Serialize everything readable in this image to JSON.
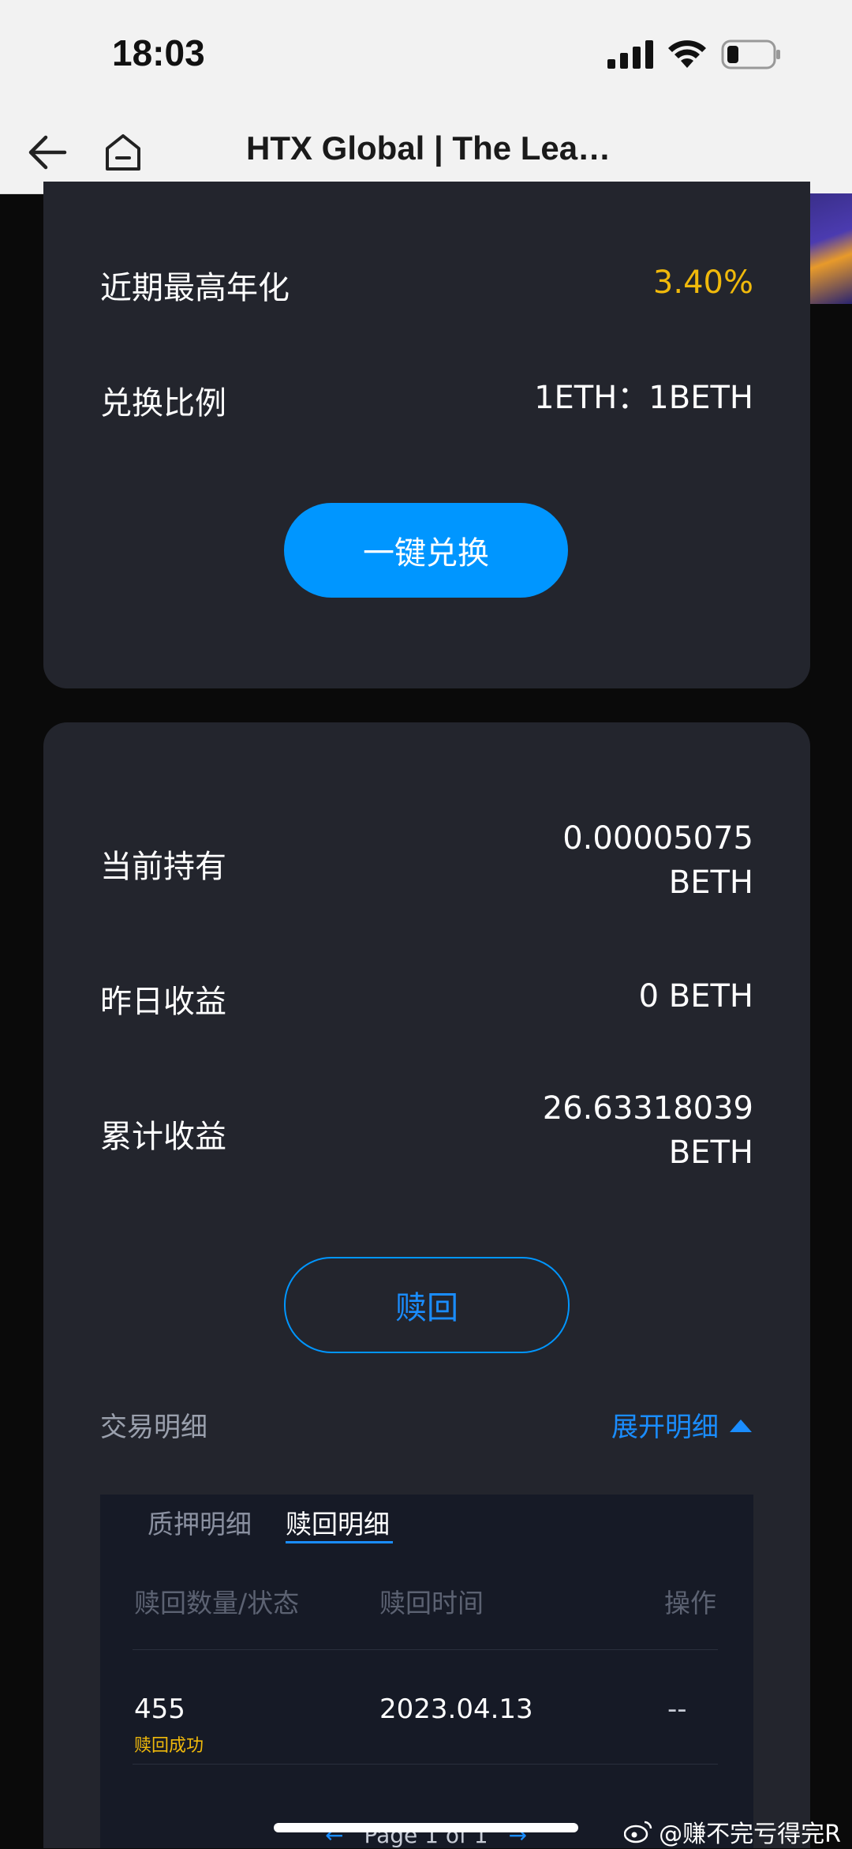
{
  "status_bar": {
    "time": "18:03"
  },
  "nav": {
    "title": "HTX Global | The Lea…"
  },
  "exchange": {
    "apy_label": "近期最高年化",
    "apy_value": "3.40%",
    "ratio_label": "兑换比例",
    "ratio_value": "1ETH：1BETH",
    "button": "一键兑换"
  },
  "holdings": {
    "current_label": "当前持有",
    "current_amount": "0.00005075",
    "current_unit": "BETH",
    "yesterday_label": "昨日收益",
    "yesterday_value": "0 BETH",
    "total_label": "累计收益",
    "total_amount": "26.63318039",
    "total_unit": "BETH",
    "redeem_button": "赎回"
  },
  "transactions": {
    "label": "交易明细",
    "expand": "展开明细",
    "tabs": [
      "质押明细",
      "赎回明细"
    ],
    "columns": [
      "赎回数量/状态",
      "赎回时间",
      "操作"
    ],
    "rows": [
      {
        "amount": "455",
        "status": "赎回成功",
        "time": "2023.04.13",
        "action": "--"
      }
    ],
    "pager": {
      "prev": "←",
      "text": "Page 1 of 1",
      "next": "→"
    }
  },
  "watermark": "@赚不完亏得完R"
}
